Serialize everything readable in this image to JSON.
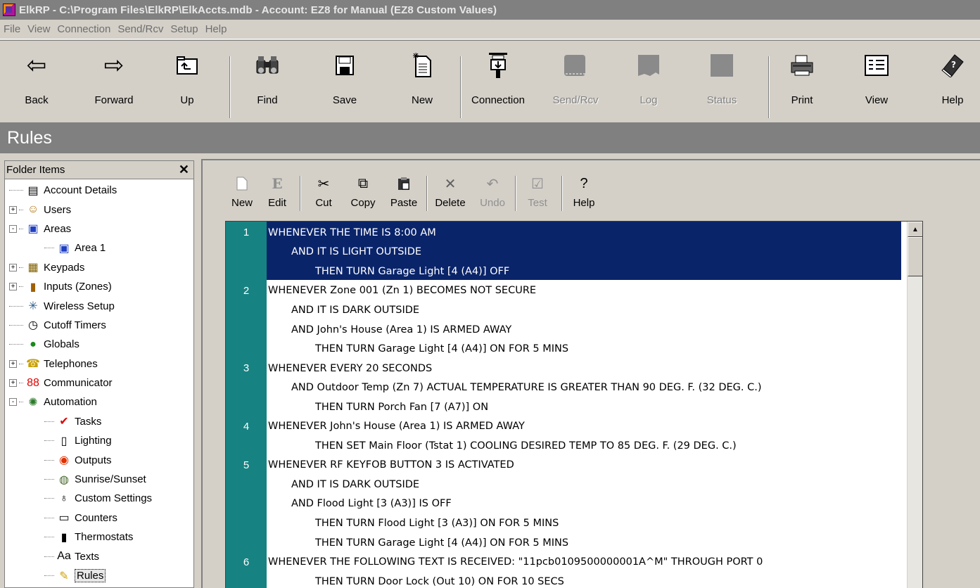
{
  "window": {
    "title": "ElkRP - C:\\Program Files\\ElkRP\\ElkAccts.mdb - Account: EZ8 for Manual (EZ8 Custom Values)"
  },
  "menu": [
    "File",
    "View",
    "Connection",
    "Send/Rcv",
    "Setup",
    "Help"
  ],
  "toolbar": {
    "back": "Back",
    "forward": "Forward",
    "up": "Up",
    "find": "Find",
    "save": "Save",
    "new": "New",
    "connection": "Connection",
    "sendrcv": "Send/Rcv",
    "log": "Log",
    "status": "Status",
    "print": "Print",
    "view": "View",
    "help": "Help"
  },
  "section_title": "Rules",
  "folder": {
    "header": "Folder Items",
    "items": [
      {
        "label": "Account Details",
        "icon": "account-details-icon",
        "expander": ""
      },
      {
        "label": "Users",
        "icon": "users-icon",
        "expander": "+"
      },
      {
        "label": "Areas",
        "icon": "areas-icon",
        "expander": "-"
      },
      {
        "label": "Area 1",
        "icon": "area-icon",
        "expander": ""
      },
      {
        "label": "Keypads",
        "icon": "keypads-icon",
        "expander": "+"
      },
      {
        "label": "Inputs (Zones)",
        "icon": "inputs-icon",
        "expander": "+"
      },
      {
        "label": "Wireless Setup",
        "icon": "wireless-icon",
        "expander": ""
      },
      {
        "label": "Cutoff Timers",
        "icon": "timer-icon",
        "expander": ""
      },
      {
        "label": "Globals",
        "icon": "globe-icon",
        "expander": ""
      },
      {
        "label": "Telephones",
        "icon": "telephone-icon",
        "expander": "+"
      },
      {
        "label": "Communicator",
        "icon": "communicator-icon",
        "expander": "+"
      },
      {
        "label": "Automation",
        "icon": "automation-icon",
        "expander": "-"
      },
      {
        "label": "Tasks",
        "icon": "tasks-icon",
        "expander": ""
      },
      {
        "label": "Lighting",
        "icon": "lighting-icon",
        "expander": ""
      },
      {
        "label": "Outputs",
        "icon": "outputs-icon",
        "expander": ""
      },
      {
        "label": "Sunrise/Sunset",
        "icon": "sunrise-icon",
        "expander": ""
      },
      {
        "label": "Custom Settings",
        "icon": "custom-settings-icon",
        "expander": ""
      },
      {
        "label": "Counters",
        "icon": "counters-icon",
        "expander": ""
      },
      {
        "label": "Thermostats",
        "icon": "thermostat-icon",
        "expander": ""
      },
      {
        "label": "Texts",
        "icon": "texts-icon",
        "expander": ""
      },
      {
        "label": "Rules",
        "icon": "rules-icon",
        "expander": ""
      }
    ]
  },
  "rules_toolbar": {
    "new": "New",
    "edit": "Edit",
    "cut": "Cut",
    "copy": "Copy",
    "paste": "Paste",
    "delete": "Delete",
    "undo": "Undo",
    "test": "Test",
    "help": "Help"
  },
  "rules": [
    {
      "num": "1",
      "text": "WHENEVER THE TIME IS 8:00 AM",
      "indent": 0
    },
    {
      "num": "",
      "text": "AND IT IS LIGHT OUTSIDE",
      "indent": 1
    },
    {
      "num": "",
      "text": "THEN TURN Garage Light [4 (A4)] OFF",
      "indent": 2
    },
    {
      "num": "2",
      "text": "WHENEVER Zone 001 (Zn 1) BECOMES NOT SECURE",
      "indent": 0
    },
    {
      "num": "",
      "text": "AND IT IS DARK OUTSIDE",
      "indent": 1
    },
    {
      "num": "",
      "text": "AND John's House (Area 1) IS ARMED AWAY",
      "indent": 1
    },
    {
      "num": "",
      "text": "THEN TURN Garage Light [4 (A4)] ON FOR 5 MINS",
      "indent": 2
    },
    {
      "num": "3",
      "text": "WHENEVER EVERY 20 SECONDS",
      "indent": 0
    },
    {
      "num": "",
      "text": "AND Outdoor Temp (Zn 7) ACTUAL TEMPERATURE IS GREATER THAN 90 DEG. F. (32 DEG. C.)",
      "indent": 1
    },
    {
      "num": "",
      "text": "THEN TURN Porch Fan [7 (A7)] ON",
      "indent": 2
    },
    {
      "num": "4",
      "text": "WHENEVER  John's House (Area 1) IS ARMED AWAY",
      "indent": 0
    },
    {
      "num": "",
      "text": "THEN SET Main Floor (Tstat 1) COOLING DESIRED TEMP TO 85 DEG. F. (29 DEG. C.)",
      "indent": 2
    },
    {
      "num": "5",
      "text": "WHENEVER  RF KEYFOB BUTTON 3 IS ACTIVATED",
      "indent": 0
    },
    {
      "num": "",
      "text": "AND IT IS DARK OUTSIDE",
      "indent": 1
    },
    {
      "num": "",
      "text": "AND Flood Light [3 (A3)] IS OFF",
      "indent": 1
    },
    {
      "num": "",
      "text": "THEN TURN Flood Light [3 (A3)] ON FOR 5 MINS",
      "indent": 2
    },
    {
      "num": "",
      "text": "THEN TURN Garage Light [4 (A4)] ON FOR 5 MINS",
      "indent": 2
    },
    {
      "num": "6",
      "text": "WHENEVER THE FOLLOWING TEXT IS RECEIVED: \"11pcb0109500000001A^M\" THROUGH PORT 0",
      "indent": 0
    },
    {
      "num": "",
      "text": "THEN TURN Door Lock (Out 10) ON FOR 10 SECS",
      "indent": 2
    }
  ]
}
